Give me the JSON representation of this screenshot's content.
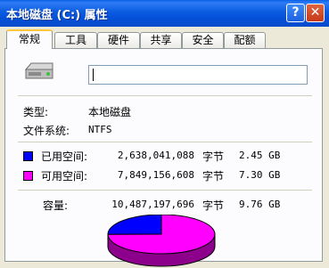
{
  "window": {
    "title": "本地磁盘 (C:) 属性",
    "help_label": "?",
    "close_label": "✕"
  },
  "tabs": [
    "常规",
    "工具",
    "硬件",
    "共享",
    "安全",
    "配额"
  ],
  "general": {
    "drive_icon": "hard-drive-icon",
    "name_value": "",
    "type_label": "类型:",
    "type_value": "本地磁盘",
    "fs_label": "文件系统:",
    "fs_value": "NTFS",
    "used": {
      "label": "已用空间:",
      "bytes": "2,638,041,088",
      "unit": "字节",
      "size": "2.45 GB",
      "color": "#0000FF"
    },
    "free": {
      "label": "可用空间:",
      "bytes": "7,849,156,608",
      "unit": "字节",
      "size": "7.30 GB",
      "color": "#FF00FF"
    },
    "capacity": {
      "label": "容量:",
      "bytes": "10,487,197,696",
      "unit": "字节",
      "size": "9.76 GB"
    }
  },
  "chart_data": {
    "type": "pie",
    "categories": [
      "已用空间",
      "可用空间"
    ],
    "values": [
      2638041088,
      7849156608
    ],
    "colors": [
      "#0000FF",
      "#FF00FF"
    ]
  }
}
